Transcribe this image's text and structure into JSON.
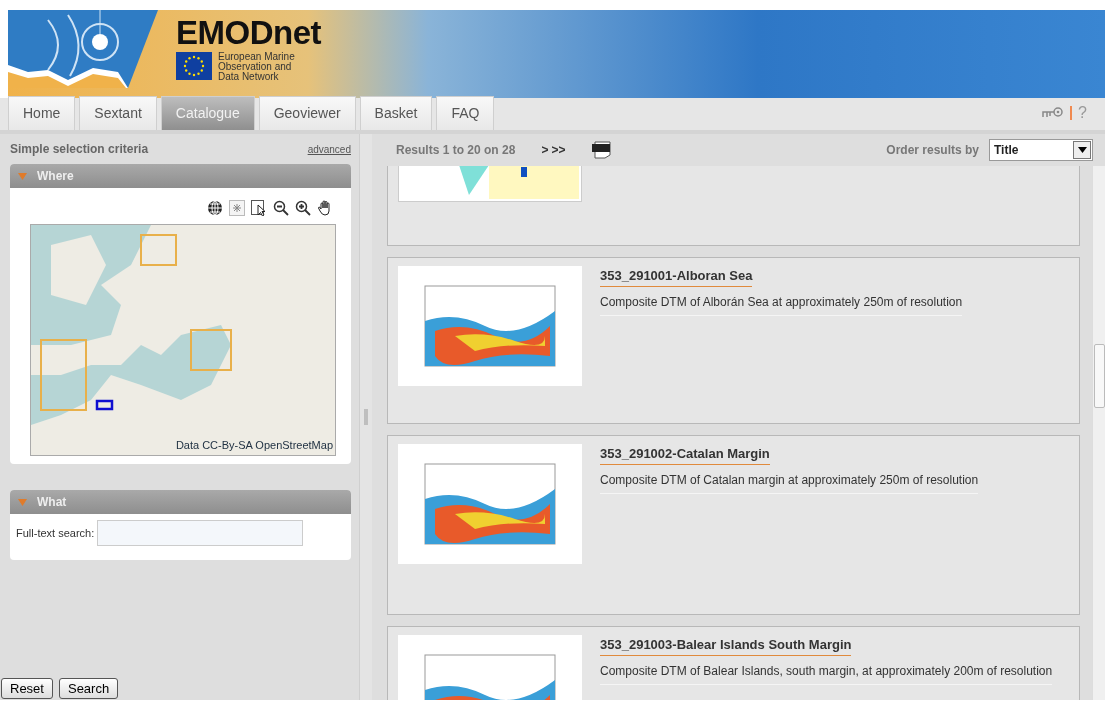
{
  "header": {
    "title": "EMODnet",
    "subtitle": [
      "European Marine",
      "Observation and",
      "Data Network"
    ]
  },
  "tabs": [
    {
      "label": "Home",
      "selected": false
    },
    {
      "label": "Sextant",
      "selected": false
    },
    {
      "label": "Catalogue",
      "selected": true
    },
    {
      "label": "Geoviewer",
      "selected": false
    },
    {
      "label": "Basket",
      "selected": false
    },
    {
      "label": "FAQ",
      "selected": false
    }
  ],
  "help": "?",
  "sidebar": {
    "title": "Simple selection criteria",
    "advanced_link": "advanced",
    "where": {
      "title": "Where",
      "expanded": true,
      "map_attribution": "Data CC-By-SA OpenStreetMap"
    },
    "what": {
      "title": "What",
      "expanded": true,
      "search_label": "Full-text search:"
    },
    "buttons": [
      "Reset",
      "Search"
    ]
  },
  "results": {
    "summary": "Results 1 to 20 on 28",
    "pager": [
      ">",
      ">>"
    ],
    "order_label": "Order results by",
    "order_value": "Title",
    "records": [
      {
        "title": "353_291001-Alboran Sea",
        "description": "Composite DTM of Alborán Sea at approximately 250m of resolution"
      },
      {
        "title": "353_291002-Catalan Margin",
        "description": "Composite DTM of Catalan margin at approximately 250m of resolution"
      },
      {
        "title": "353_291003-Balear Islands South Margin",
        "description": "Composite DTM of Balear Islands, south margin, at approximately 200m of resolution"
      }
    ]
  }
}
